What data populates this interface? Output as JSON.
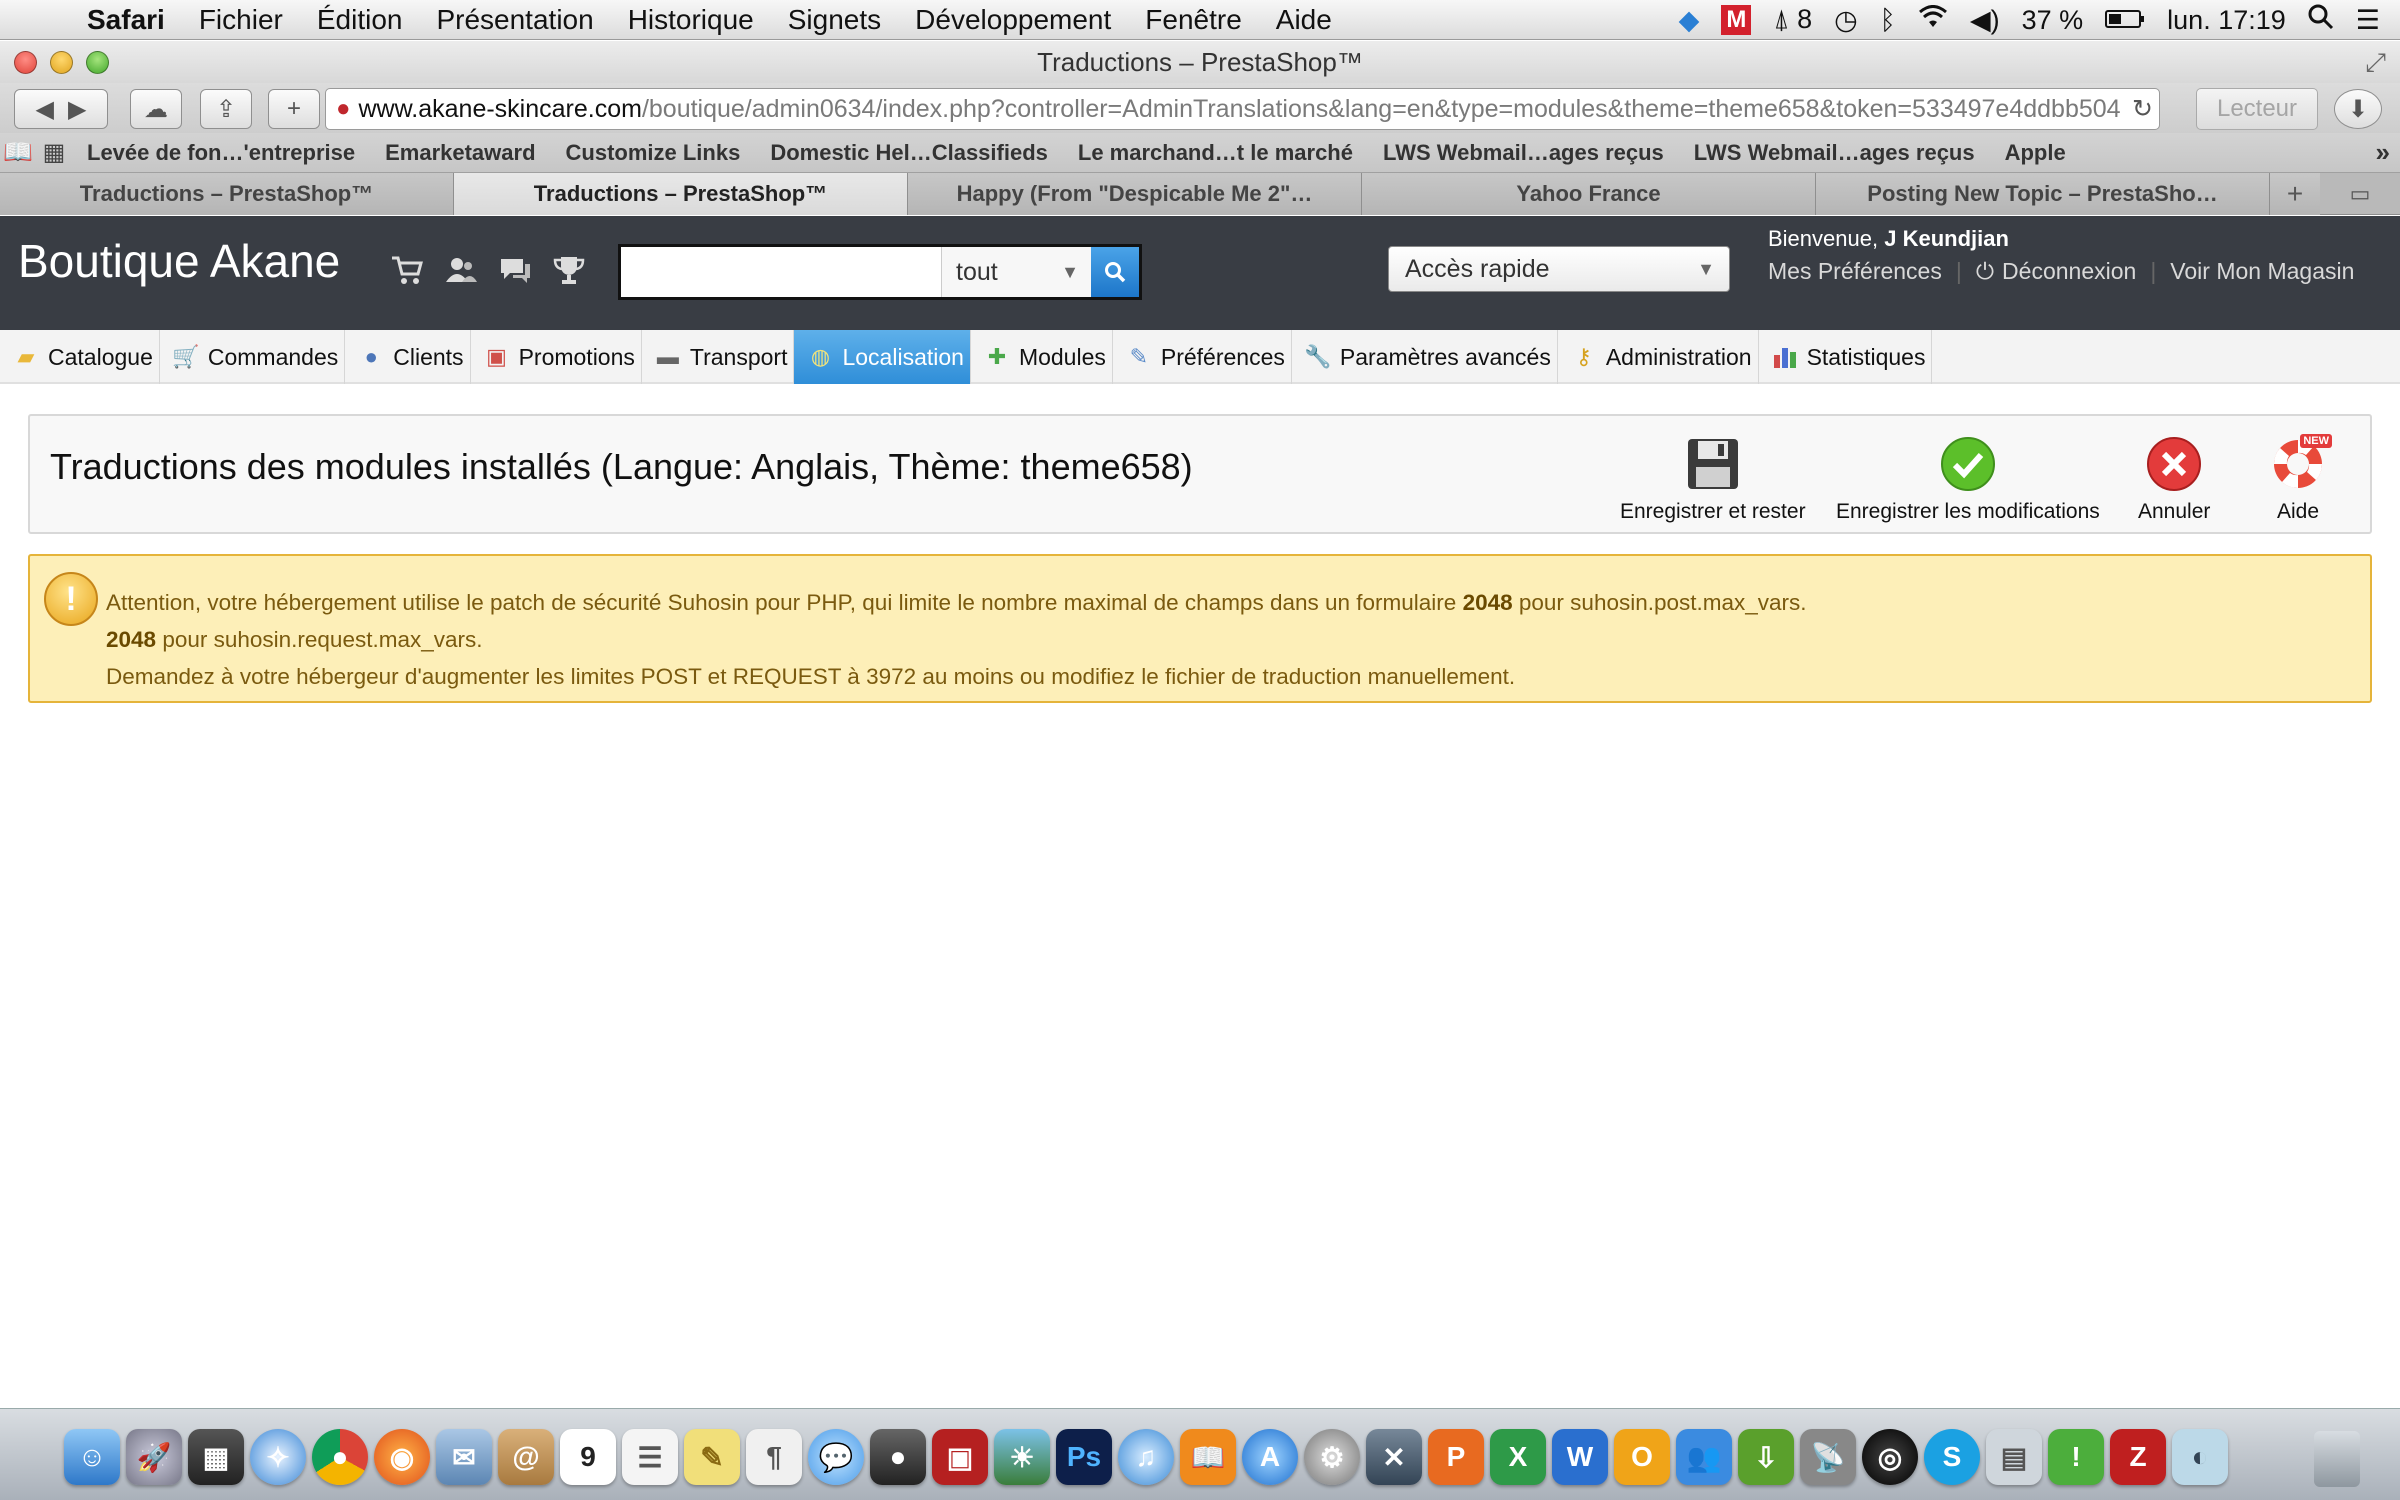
{
  "menubar": {
    "app": "Safari",
    "items": [
      "Fichier",
      "Édition",
      "Présentation",
      "Historique",
      "Signets",
      "Développement",
      "Fenêtre",
      "Aide"
    ],
    "status": {
      "notification_count": "8",
      "battery": "37 %",
      "clock": "lun. 17:19"
    }
  },
  "window": {
    "title": "Traductions – PrestaShop™"
  },
  "toolbar": {
    "url_domain": "www.akane-skincare.com",
    "url_path": "/boutique/admin0634/index.php?controller=AdminTranslations&lang=en&type=modules&theme=theme658&token=533497e4ddbb504",
    "reader_label": "Lecteur"
  },
  "bookmarks": [
    "Levée de fon…'entreprise",
    "Emarketaward",
    "Customize Links",
    "Domestic Hel…Classifieds",
    "Le marchand…t le marché",
    "LWS Webmail…ages reçus",
    "LWS Webmail…ages reçus",
    "Apple"
  ],
  "tabs": [
    {
      "label": "Traductions – PrestaShop™",
      "active": false
    },
    {
      "label": "Traductions – PrestaShop™",
      "active": true
    },
    {
      "label": "Happy (From \"Despicable Me 2\"…",
      "active": false
    },
    {
      "label": "Yahoo France",
      "active": false
    },
    {
      "label": "Posting New Topic – PrestaSho…",
      "active": false
    }
  ],
  "ps_header": {
    "shop_name": "Boutique Akane",
    "search": {
      "value": "",
      "scope": "tout"
    },
    "quick_access": "Accès rapide",
    "welcome_prefix": "Bienvenue,",
    "user": "J Keundjian",
    "links": {
      "preferences": "Mes Préférences",
      "logout": "Déconnexion",
      "view_shop": "Voir Mon Magasin"
    }
  },
  "nav": [
    {
      "label": "Catalogue",
      "icon": "folder-icon",
      "active": false
    },
    {
      "label": "Commandes",
      "icon": "cart-icon",
      "active": false
    },
    {
      "label": "Clients",
      "icon": "user-icon",
      "active": false
    },
    {
      "label": "Promotions",
      "icon": "promotion-icon",
      "active": false
    },
    {
      "label": "Transport",
      "icon": "truck-icon",
      "active": false
    },
    {
      "label": "Localisation",
      "icon": "globe-icon",
      "active": true
    },
    {
      "label": "Modules",
      "icon": "puzzle-icon",
      "active": false
    },
    {
      "label": "Préférences",
      "icon": "preferences-icon",
      "active": false
    },
    {
      "label": "Paramètres avancés",
      "icon": "wrench-icon",
      "active": false
    },
    {
      "label": "Administration",
      "icon": "key-icon",
      "active": false
    },
    {
      "label": "Statistiques",
      "icon": "stats-icon",
      "active": false
    }
  ],
  "content": {
    "title": "Traductions des modules installés (Langue: Anglais, Thème: theme658)",
    "actions": {
      "save_stay": "Enregistrer et rester",
      "save": "Enregistrer les modifications",
      "cancel": "Annuler",
      "help": "Aide",
      "help_badge": "NEW"
    },
    "warning": {
      "line1_a": "Attention, votre hébergement utilise le patch de sécurité Suhosin pour PHP, qui limite le nombre maximal de champs dans un formulaire",
      "line1_num": "2048",
      "line1_b": "pour suhosin.post.max_vars.",
      "line2_num": "2048",
      "line2_b": "pour suhosin.request.max_vars.",
      "line3": "Demandez à votre hébergeur d'augmenter les limites POST et REQUEST à 3972 au moins ou modifiez le fichier de traduction manuellement."
    }
  },
  "colors": {
    "header_bg": "#393d44",
    "nav_active": "#3e9ade",
    "warning_bg": "#fdefb8",
    "warning_border": "#e5b43a"
  }
}
